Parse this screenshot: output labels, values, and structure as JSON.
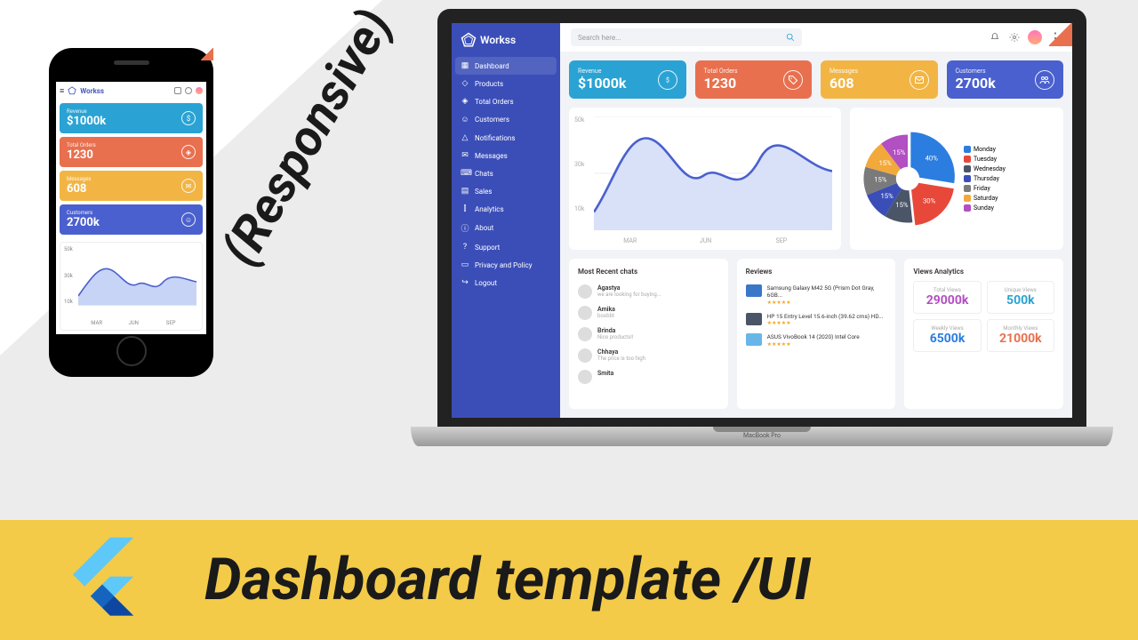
{
  "brand": "Workss",
  "overlay": {
    "responsive": "(Responsive)",
    "banner_title": "Dashboard template /UI",
    "macbook": "MacBook Pro"
  },
  "searchPlaceholder": "Search here...",
  "sidebar": [
    {
      "label": "Dashboard"
    },
    {
      "label": "Products"
    },
    {
      "label": "Total Orders"
    },
    {
      "label": "Customers"
    },
    {
      "label": "Notifications"
    },
    {
      "label": "Messages"
    },
    {
      "label": "Chats"
    },
    {
      "label": "Sales"
    },
    {
      "label": "Analytics"
    },
    {
      "label": "About"
    },
    {
      "label": "Support"
    },
    {
      "label": "Privacy and Policy"
    },
    {
      "label": "Logout"
    }
  ],
  "kpis": [
    {
      "label": "Revenue",
      "value": "$1000k",
      "color": "#2aa3d4"
    },
    {
      "label": "Total Orders",
      "value": "1230",
      "color": "#e8704f"
    },
    {
      "label": "Messages",
      "value": "608",
      "color": "#f2b544"
    },
    {
      "label": "Customers",
      "value": "2700k",
      "color": "#4a60cf"
    }
  ],
  "chart_data": {
    "area": {
      "type": "area",
      "x": [
        "MAR",
        "JUN",
        "SEP"
      ],
      "y_ticks": [
        "10k",
        "30k",
        "50k"
      ],
      "series": [
        {
          "name": "",
          "values": [
            12,
            48,
            26,
            38,
            22,
            44,
            40
          ]
        }
      ],
      "color": "#4a60cf"
    },
    "pie": {
      "type": "pie",
      "slices": [
        {
          "label": "Monday",
          "value": 40,
          "color": "#2b7de0"
        },
        {
          "label": "Tuesday",
          "value": 30,
          "color": "#e8483a"
        },
        {
          "label": "Wednesday",
          "value": 15,
          "color": "#4a5568"
        },
        {
          "label": "Thursday",
          "value": 15,
          "color": "#3b4eb8"
        },
        {
          "label": "Friday",
          "value": 15,
          "color": "#7a7a7a"
        },
        {
          "label": "Saturday",
          "value": 15,
          "color": "#f2a93b"
        },
        {
          "label": "Sunday",
          "value": 15,
          "color": "#b24fc2"
        }
      ]
    }
  },
  "sections": {
    "chats": "Most Recent chats",
    "reviews": "Reviews",
    "views": "Views Analytics"
  },
  "chats": [
    {
      "name": "Agastya",
      "sub": "we are looking for buying..."
    },
    {
      "name": "Amika",
      "sub": "boobbt"
    },
    {
      "name": "Brinda",
      "sub": "Nice products!!"
    },
    {
      "name": "Chhaya",
      "sub": "The price is too high"
    },
    {
      "name": "Smita",
      "sub": ""
    }
  ],
  "reviews": [
    {
      "title": "Samsung Galaxy M42 5G (Prism Dot Gray, 6GB...",
      "thumb": "#3a77c9"
    },
    {
      "title": "HP 15 Entry Level 15.6-inch (39.62 cms) HD...",
      "thumb": "#4a5568"
    },
    {
      "title": "ASUS VivoBook 14 (2020) Intel Core",
      "thumb": "#68b6e8"
    }
  ],
  "views": [
    {
      "label": "Total Views",
      "value": "29000k",
      "color": "#b24fc2"
    },
    {
      "label": "Unique Views",
      "value": "500k",
      "color": "#2aa3d4"
    },
    {
      "label": "Weekly Views",
      "value": "6500k",
      "color": "#2b7de0"
    },
    {
      "label": "Monthly Views",
      "value": "21000k",
      "color": "#e8704f"
    }
  ]
}
